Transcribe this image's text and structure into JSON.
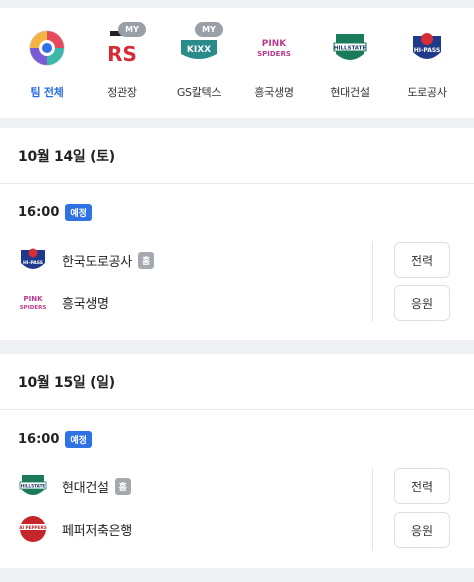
{
  "teams": [
    {
      "label": "팀 전체",
      "active": true,
      "my": false
    },
    {
      "label": "정관장",
      "active": false,
      "my": true,
      "logo_text": "RS"
    },
    {
      "label": "GS칼텍스",
      "active": false,
      "my": true,
      "logo_text": "KIXX"
    },
    {
      "label": "흥국생명",
      "active": false,
      "my": false,
      "logo_text": "PINK SPIDERS"
    },
    {
      "label": "현대건설",
      "active": false,
      "my": false,
      "logo_text": "HILLSTATE"
    },
    {
      "label": "도로공사",
      "active": false,
      "my": false,
      "logo_text": "HI-PASS"
    }
  ],
  "my_badge": "MY",
  "days": [
    {
      "date": "10월 14일 (토)",
      "time": "16:00",
      "status": "예정",
      "home": {
        "name": "한국도로공사",
        "badge": "홈",
        "logo_text": "HI-PASS"
      },
      "away": {
        "name": "흥국생명",
        "logo_text": "PINK SPIDERS"
      },
      "buttons": {
        "analysis": "전력",
        "cheer": "응원"
      }
    },
    {
      "date": "10월 15일 (일)",
      "time": "16:00",
      "status": "예정",
      "home": {
        "name": "현대건설",
        "badge": "홈",
        "logo_text": "HILLSTATE"
      },
      "away": {
        "name": "페퍼저축은행",
        "logo_text": "AI PEPPERS"
      },
      "buttons": {
        "analysis": "전력",
        "cheer": "응원"
      }
    }
  ],
  "colors": {
    "accent": "#2f72e4",
    "active_label": "#2a6fe0",
    "background": "#eef0f4",
    "exco_red": "#d42d36",
    "hipass_blue": "#1f3a8a",
    "pink": "#b93a8f",
    "hillstate_green": "#1b7a5a",
    "kixx_teal": "#2b8a8a",
    "peppers_red": "#c4262b"
  }
}
